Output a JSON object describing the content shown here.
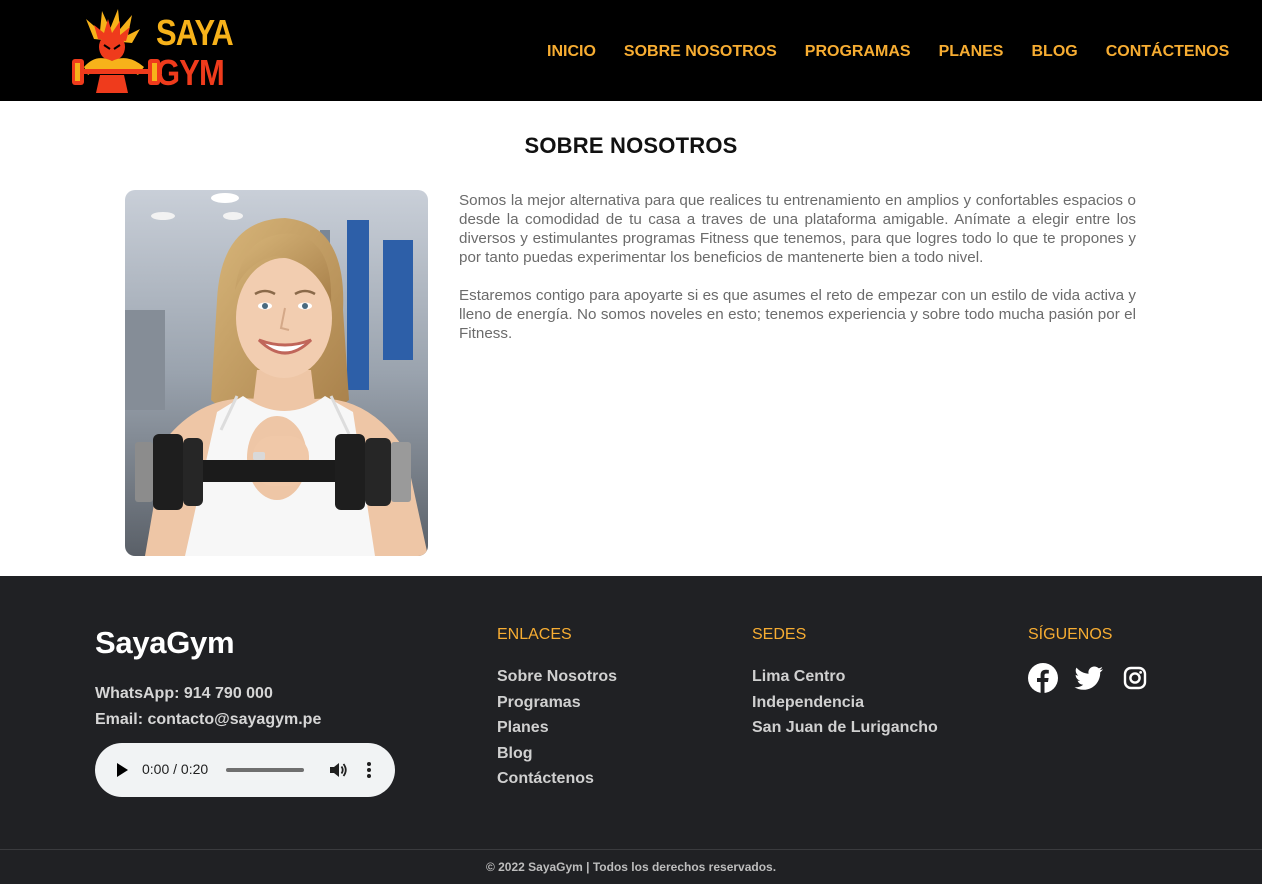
{
  "header": {
    "logo": {
      "line1": "SAYA",
      "line2": "GYM"
    },
    "nav": [
      "INICIO",
      "SOBRE NOSOTROS",
      "PROGRAMAS",
      "PLANES",
      "BLOG",
      "CONTÁCTENOS"
    ]
  },
  "about": {
    "title": "SOBRE NOSOTROS",
    "paragraph1": "Somos la mejor alternativa para que realices tu entrenamiento en amplios y confortables espacios o desde la comodidad de tu casa a traves de una plataforma amigable. Anímate a elegir entre los diversos y estimulantes programas Fitness que tenemos, para que logres todo lo que te propones y por tanto puedas experimentar los beneficios de mantenerte bien a todo nivel.",
    "paragraph2": "Estaremos contigo para apoyarte si es que asumes el reto de empezar con un estilo de vida activa y lleno de energía. No somos noveles en esto; tenemos experiencia y sobre todo mucha pasión por el Fitness."
  },
  "footer": {
    "brand": "SayaGym",
    "whatsapp": "WhatsApp: 914 790 000",
    "email": "Email: contacto@sayagym.pe",
    "audio": {
      "time": "0:00 / 0:20"
    },
    "enlaces": {
      "heading": "ENLACES",
      "items": [
        "Sobre Nosotros",
        "Programas",
        "Planes",
        "Blog",
        "Contáctenos"
      ]
    },
    "sedes": {
      "heading": "SEDES",
      "items": [
        "Lima Centro",
        "Independencia",
        "San Juan de Lurigancho"
      ]
    },
    "siguenos": {
      "heading": "SÍGUENOS",
      "icons": [
        "facebook-icon",
        "twitter-icon",
        "instagram-icon"
      ]
    },
    "copyright": "© 2022 SayaGym | Todos los derechos reservados."
  },
  "colors": {
    "accent": "#f7ad32",
    "header_bg": "#000000",
    "footer_bg": "#202124"
  }
}
